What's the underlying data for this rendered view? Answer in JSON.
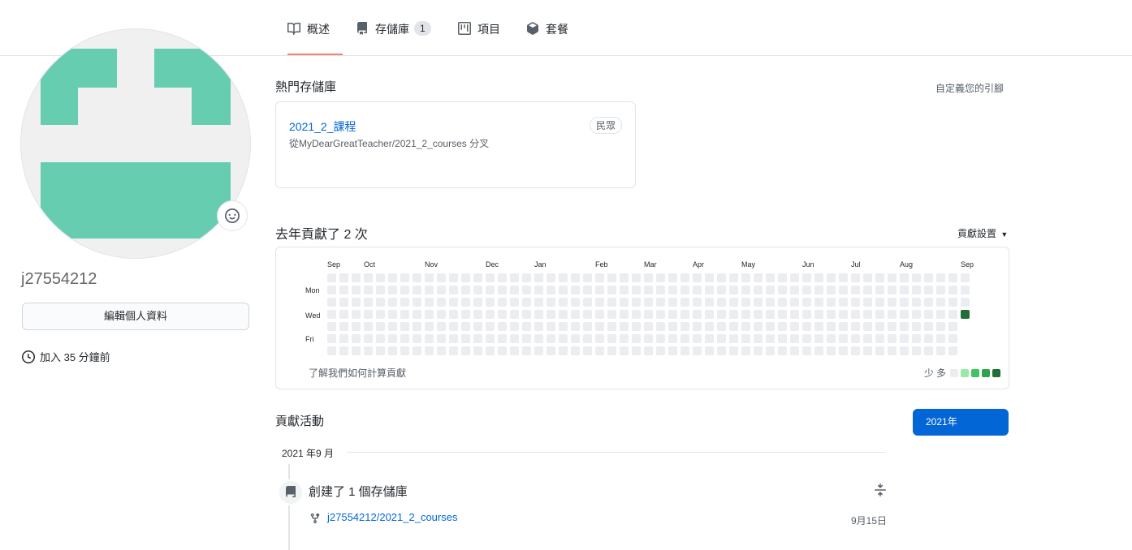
{
  "tabs": [
    {
      "label": "概述",
      "icon": "book-icon",
      "selected": true
    },
    {
      "label": "存儲庫",
      "icon": "repo-icon",
      "count": "1"
    },
    {
      "label": "項目",
      "icon": "project-icon"
    },
    {
      "label": "套餐",
      "icon": "package-icon"
    }
  ],
  "profile": {
    "username": "j27554212",
    "edit_label": "編輯個人資料",
    "joined": "加入 35 分鐘前"
  },
  "pinned": {
    "heading": "熱門存儲庫",
    "customize": "自定義您的引腳",
    "repo": {
      "name": "2021_2_課程",
      "badge": "民眾",
      "forked_from": "從MyDearGreatTeacher/2021_2_courses 分叉"
    }
  },
  "contributions": {
    "heading": "去年貢獻了 2 次",
    "settings": "貢獻設置",
    "months": [
      "Sep",
      "Oct",
      "Nov",
      "Dec",
      "Jan",
      "Feb",
      "Mar",
      "Apr",
      "May",
      "Jun",
      "Jul",
      "Aug",
      "Sep"
    ],
    "days": [
      "Mon",
      "Wed",
      "Fri"
    ],
    "learn_link": "了解我們如何計算貢獻",
    "legend_less": "少",
    "legend_more": "多",
    "colors": [
      "#ebedf0",
      "#9be9a8",
      "#40c463",
      "#30a14e",
      "#216e39"
    ],
    "weeks": 53,
    "last_week_days": 4,
    "highlight": {
      "week": 53,
      "day": 3,
      "level": 4
    }
  },
  "activity": {
    "heading": "貢獻活動",
    "year_button": "2021年",
    "month_label": "2021 年9 月",
    "event_title": "創建了 1 個存儲庫",
    "repo_link": "j27554212/2021_2_courses",
    "date": "9月15日"
  }
}
